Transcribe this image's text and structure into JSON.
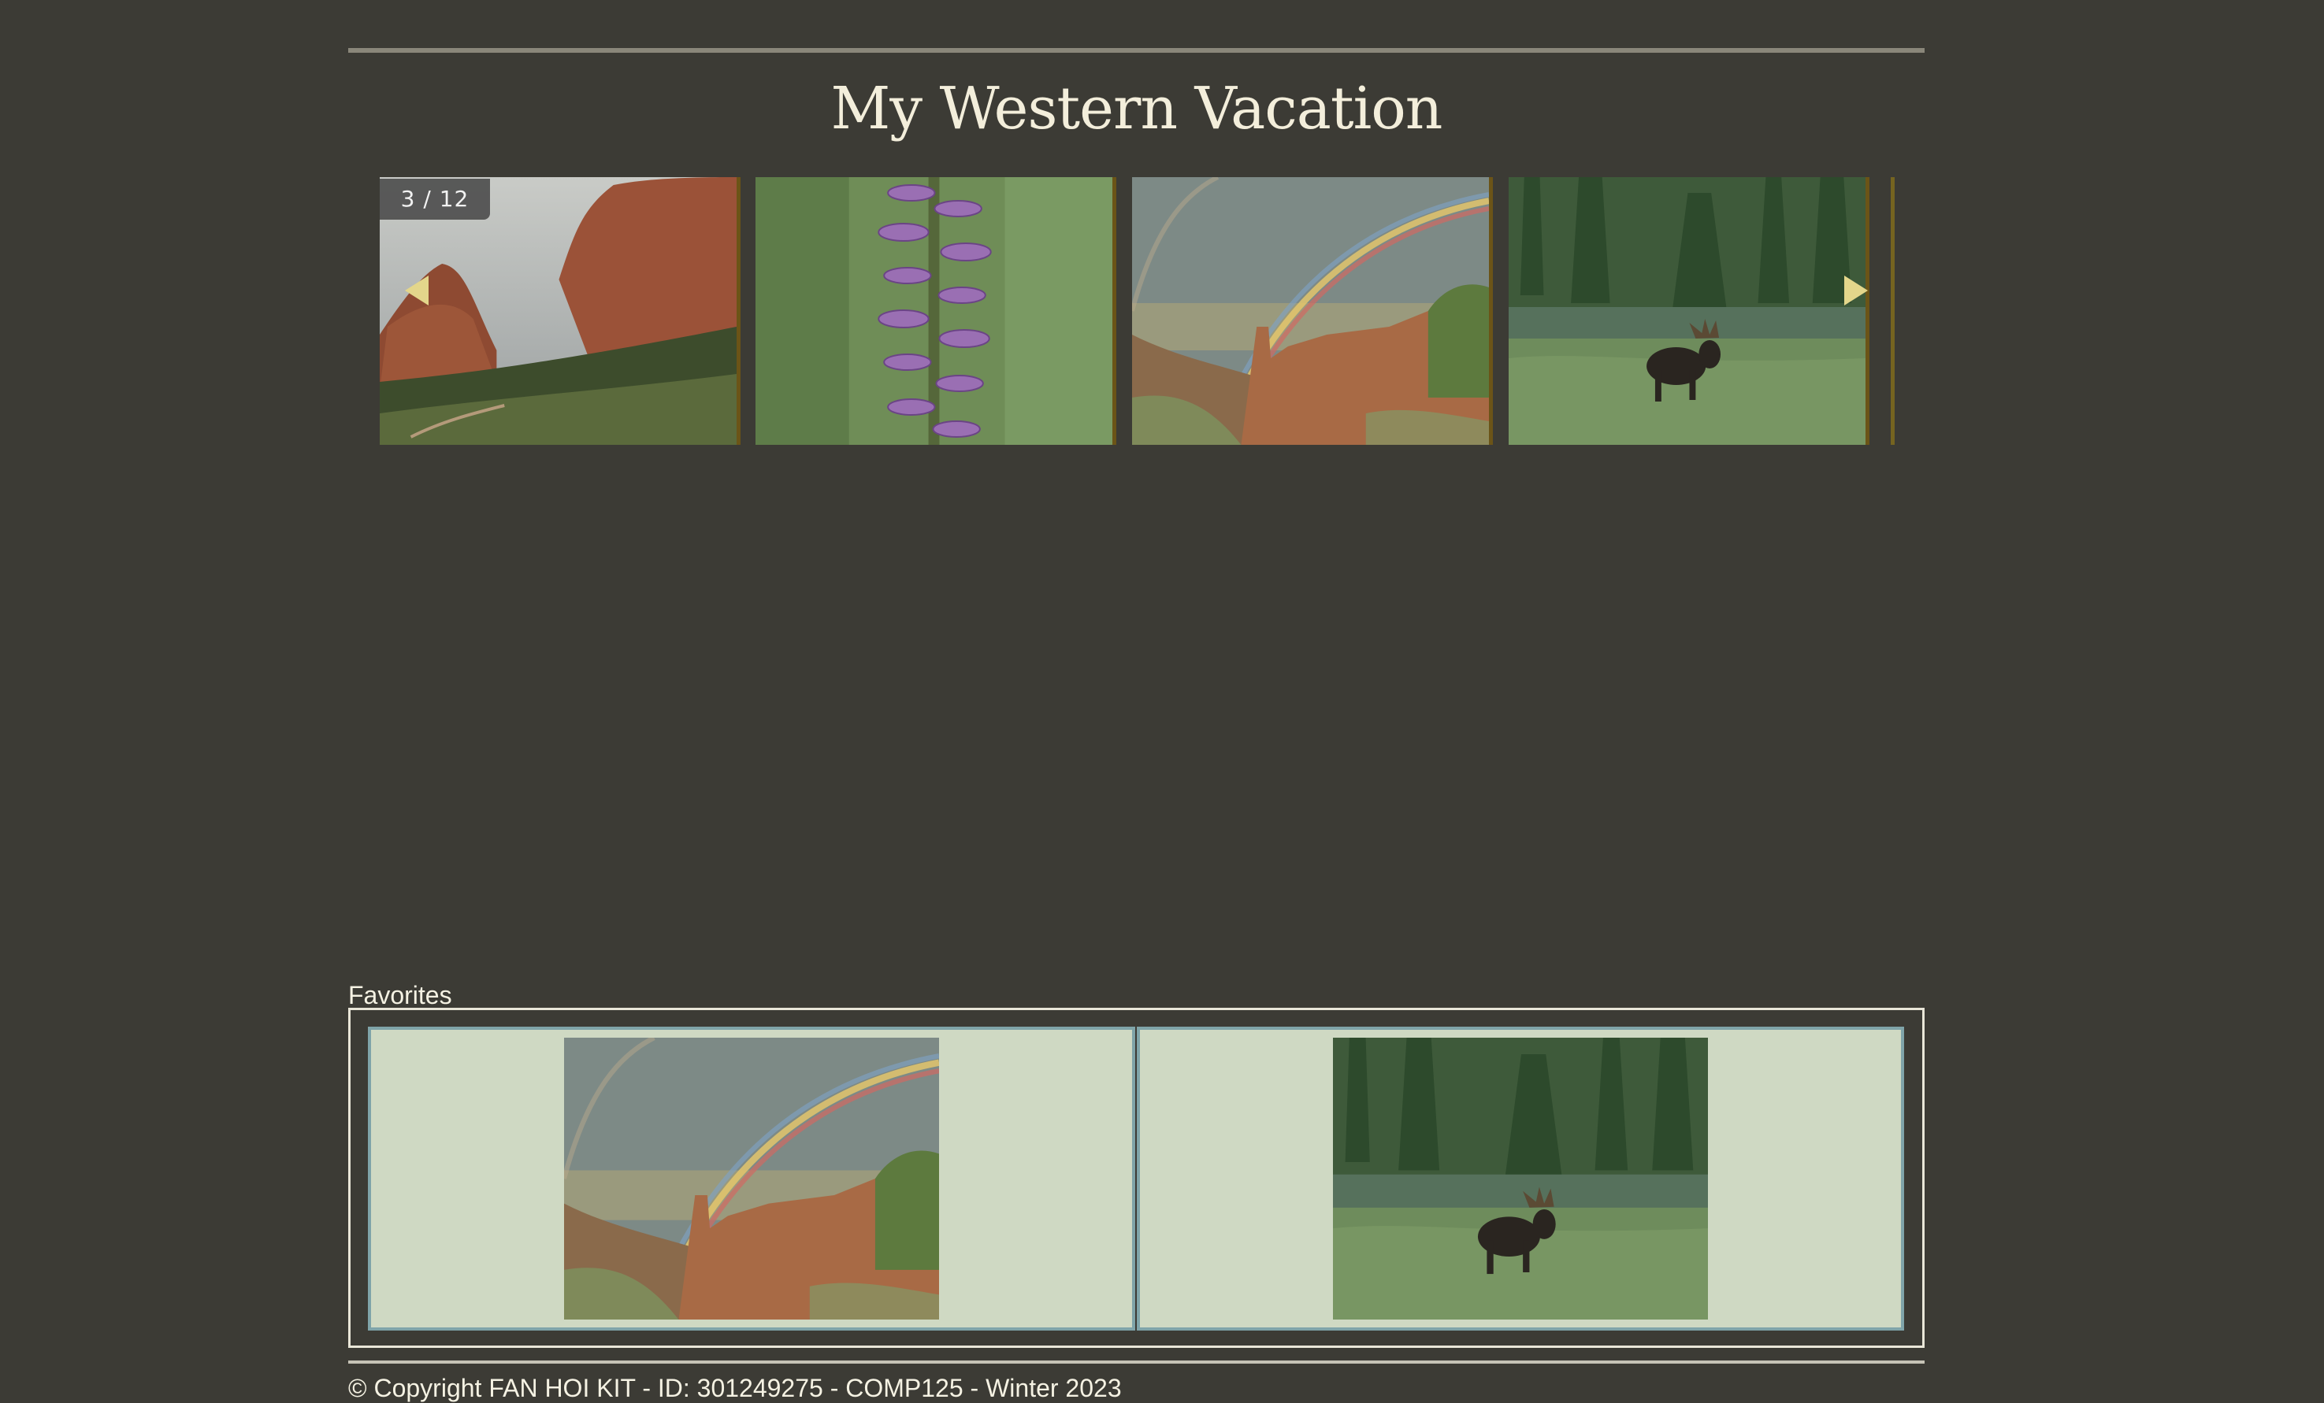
{
  "page": {
    "title": "My Western Vacation"
  },
  "slideshow": {
    "counter": "3 / 12",
    "slides": [
      {
        "name": "red-rocks-slide",
        "icon": "photo-canyon-red-rocks"
      },
      {
        "name": "orchid-slide",
        "icon": "photo-purple-orchid"
      },
      {
        "name": "rainbow-slide",
        "icon": "photo-rainbow-canyon"
      },
      {
        "name": "moose-slide",
        "icon": "photo-moose-pond"
      }
    ],
    "prev_icon": "chevron-left-icon",
    "next_icon": "chevron-right-icon"
  },
  "favorites": {
    "label": "Favorites",
    "items": [
      {
        "name": "favorite-rainbow",
        "icon": "photo-rainbow-canyon"
      },
      {
        "name": "favorite-moose",
        "icon": "photo-moose-pond"
      }
    ]
  },
  "footer": {
    "text": "© Copyright FAN HOI KIT - ID: 301249275 - COMP125 - Winter 2023"
  },
  "colors": {
    "background": "#3c3b35",
    "title": "#f3eedb",
    "arrow": "#e3d68b",
    "favorites_cell": "#cfd9c3",
    "favorites_cell_border": "#7fa4a9"
  }
}
